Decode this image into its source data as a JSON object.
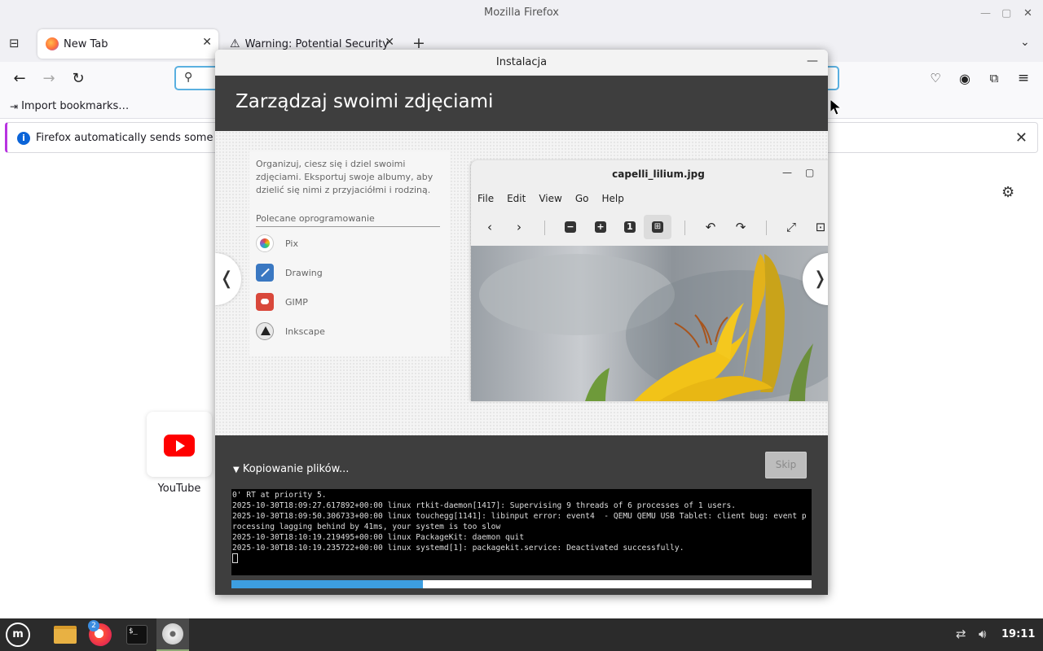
{
  "firefox": {
    "window_title": "Mozilla Firefox",
    "tabs": [
      {
        "label": "New Tab",
        "icon": "firefox-icon"
      },
      {
        "label": "Warning: Potential Security",
        "icon": "warning-icon"
      }
    ],
    "new_tab_glyph": "+",
    "url_placeholder": "",
    "bookmarks_toolbar": {
      "import_label": "Import bookmarks…"
    },
    "notification": {
      "text": "Firefox automatically sends some dat"
    },
    "shortcuts": [
      {
        "label": "YouTube",
        "icon": "youtube-icon"
      }
    ]
  },
  "installer": {
    "window_title": "Instalacja",
    "heading": "Zarządzaj swoimi zdjęciami",
    "slide": {
      "description": "Organizuj, ciesz się i dziel swoimi zdjęciami. Eksportuj swoje albumy, aby dzielić się nimi z przyjaciółmi i rodziną.",
      "recommended_label": "Polecane oprogramowanie",
      "apps": [
        {
          "name": "Pix",
          "icon": "pix-icon"
        },
        {
          "name": "Drawing",
          "icon": "drawing-icon"
        },
        {
          "name": "GIMP",
          "icon": "gimp-icon"
        },
        {
          "name": "Inkscape",
          "icon": "inkscape-icon"
        }
      ],
      "viewer": {
        "title": "capelli_lilium.jpg",
        "menu": [
          "File",
          "Edit",
          "View",
          "Go",
          "Help"
        ]
      }
    },
    "progress": {
      "label": "Kopiowanie plików...",
      "skip_label": "Skip",
      "percent": 33,
      "log_lines": [
        "0' RT at priority 5.",
        "2025-10-30T18:09:27.617892+00:00 linux rtkit-daemon[1417]: Supervising 9 threads of 6 processes of 1 users.",
        "2025-10-30T18:09:50.306733+00:00 linux touchegg[1141]: libinput error: event4  - QEMU QEMU USB Tablet: client bug: event processing lagging behind by 41ms, your system is too slow",
        "2025-10-30T18:10:19.219495+00:00 linux PackageKit: daemon quit",
        "2025-10-30T18:10:19.235722+00:00 linux systemd[1]: packagekit.service: Deactivated successfully."
      ]
    }
  },
  "taskbar": {
    "firefox_badge": "2",
    "clock": "19:11"
  },
  "colors": {
    "installer_dark": "#3e3e3e",
    "progress_fill": "#3d9ee0",
    "notification_accent": "#b833e1",
    "url_focus": "#5ab0e0"
  }
}
